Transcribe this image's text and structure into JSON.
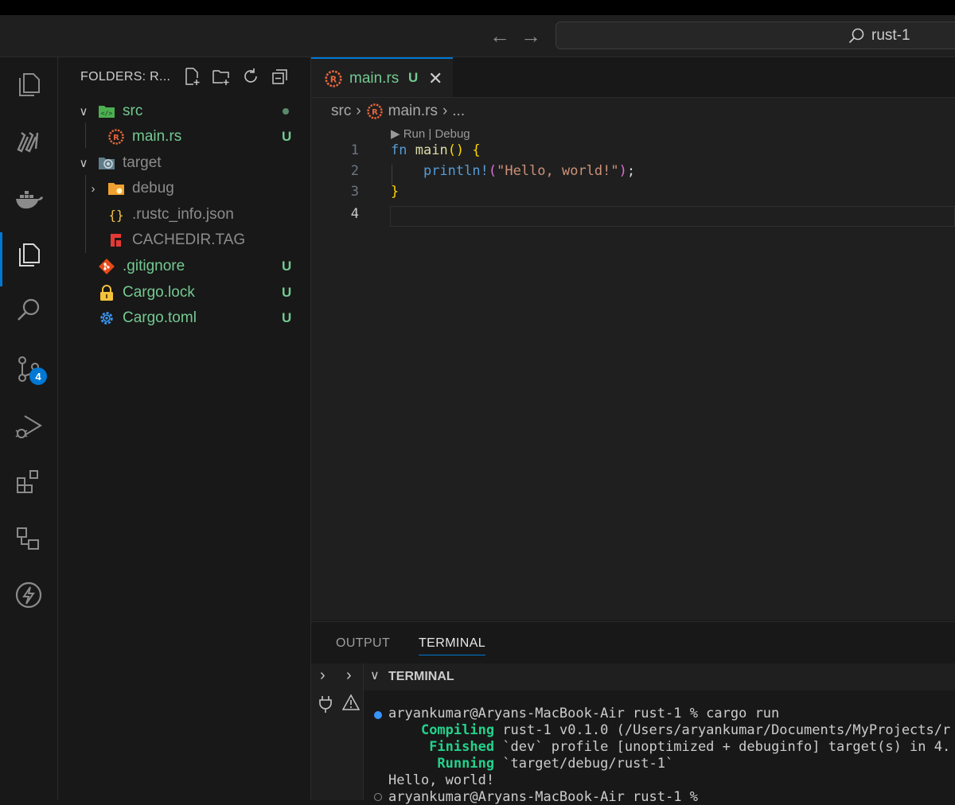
{
  "titlebar": {
    "search_text": "rust-1"
  },
  "activity_bar": {
    "scm_badge": "4"
  },
  "explorer": {
    "header": "FOLDERS: R...",
    "items": [
      {
        "label": "src",
        "status": ""
      },
      {
        "label": "main.rs",
        "status": "U"
      },
      {
        "label": "target",
        "status": ""
      },
      {
        "label": "debug",
        "status": ""
      },
      {
        "label": ".rustc_info.json",
        "status": ""
      },
      {
        "label": "CACHEDIR.TAG",
        "status": ""
      },
      {
        "label": ".gitignore",
        "status": "U"
      },
      {
        "label": "Cargo.lock",
        "status": "U"
      },
      {
        "label": "Cargo.toml",
        "status": "U"
      }
    ]
  },
  "editor": {
    "tab": {
      "label": "main.rs",
      "status": "U"
    },
    "breadcrumb": {
      "folder": "src",
      "file": "main.rs",
      "more": "..."
    },
    "codelens": "▶ Run | Debug",
    "line_numbers": [
      "1",
      "2",
      "3",
      "4"
    ],
    "code": {
      "l1_kw": "fn",
      "l1_name": "main",
      "l1_parens": "()",
      "l1_brace": "{",
      "l2_macro": "println!",
      "l2_open": "(",
      "l2_string": "\"Hello, world!\"",
      "l2_close": ")",
      "l2_semi": ";",
      "l3_brace": "}"
    }
  },
  "panel": {
    "tabs": [
      "OUTPUT",
      "TERMINAL"
    ],
    "terminal_title": "TERMINAL",
    "terminal_lines": {
      "cmd": "aryankumar@Aryans-MacBook-Air rust-1 % cargo run",
      "compiling_label": "Compiling",
      "compiling_text": " rust-1 v0.1.0 (/Users/aryankumar/Documents/MyProjects/r",
      "finished_label": "Finished",
      "finished_text": " `dev` profile [unoptimized + debuginfo] target(s) in 4.",
      "running_label": "Running",
      "running_text": " `target/debug/rust-1`",
      "output": "Hello, world!",
      "prompt": "aryankumar@Aryans-MacBook-Air rust-1 %"
    }
  },
  "colors": {
    "accent": "#0078d4",
    "git_untracked": "#73c991",
    "terminal_green": "#23d18b"
  }
}
